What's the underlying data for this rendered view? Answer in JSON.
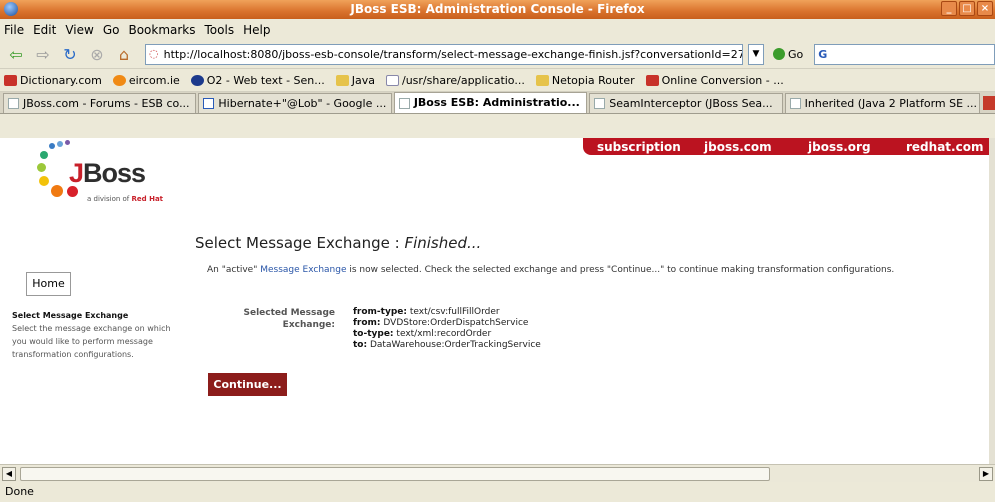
{
  "window": {
    "title": "JBoss ESB: Administration Console - Firefox"
  },
  "menu": [
    "File",
    "Edit",
    "View",
    "Go",
    "Bookmarks",
    "Tools",
    "Help"
  ],
  "nav": {
    "url": "http://localhost:8080/jboss-esb-console/transform/select-message-exchange-finish.jsf?conversationId=27",
    "go_label": "Go",
    "search_label": "G"
  },
  "bookmarks": [
    {
      "label": "Dictionary.com",
      "color": "#c8322a"
    },
    {
      "label": "eircom.ie",
      "color": "#f08a14"
    },
    {
      "label": "O2 - Web text - Sen...",
      "color": "#1c3a8c"
    },
    {
      "label": "Java",
      "color": "#e6c34a"
    },
    {
      "label": "/usr/share/applicatio...",
      "color": "#ffffff"
    },
    {
      "label": "Netopia Router",
      "color": "#e6c34a"
    },
    {
      "label": "Online Conversion - ...",
      "color": "#c8322a"
    }
  ],
  "tabs": [
    {
      "label": "JBoss.com - Forums - ESB co..."
    },
    {
      "label": "Hibernate+\"@Lob\" - Google ..."
    },
    {
      "label": "JBoss ESB: Administratio..."
    },
    {
      "label": "SeamInterceptor (JBoss Sea..."
    },
    {
      "label": "Inherited (Java 2 Platform SE ..."
    }
  ],
  "topnav": [
    "subscription",
    "jboss.com",
    "jboss.org",
    "redhat.com"
  ],
  "logo": {
    "name": "JBoss",
    "tagline_prefix": "a division of ",
    "tagline_brand": "Red Hat"
  },
  "page": {
    "title": "Select Message Exchange : ",
    "title_em": "Finished...",
    "intro_pre": "An \"active\" ",
    "intro_link": "Message Exchange",
    "intro_post": " is now selected. Check the selected exchange and press \"Continue...\" to continue making transformation configurations."
  },
  "sidebar": {
    "home_label": "Home",
    "step_title": "Select Message Exchange",
    "step_desc": "Select the message exchange on which you would like to perform message transformation configurations."
  },
  "exchange": {
    "label": "Selected Message Exchange:",
    "rows": [
      {
        "k": "from-type:",
        "v": "text/csv:fullFillOrder"
      },
      {
        "k": "from:",
        "v": "DVDStore:OrderDispatchService"
      },
      {
        "k": "to-type:",
        "v": "text/xml:recordOrder"
      },
      {
        "k": "to:",
        "v": "DataWarehouse:OrderTrackingService"
      }
    ]
  },
  "continue_label": "Continue...",
  "status": "Done"
}
